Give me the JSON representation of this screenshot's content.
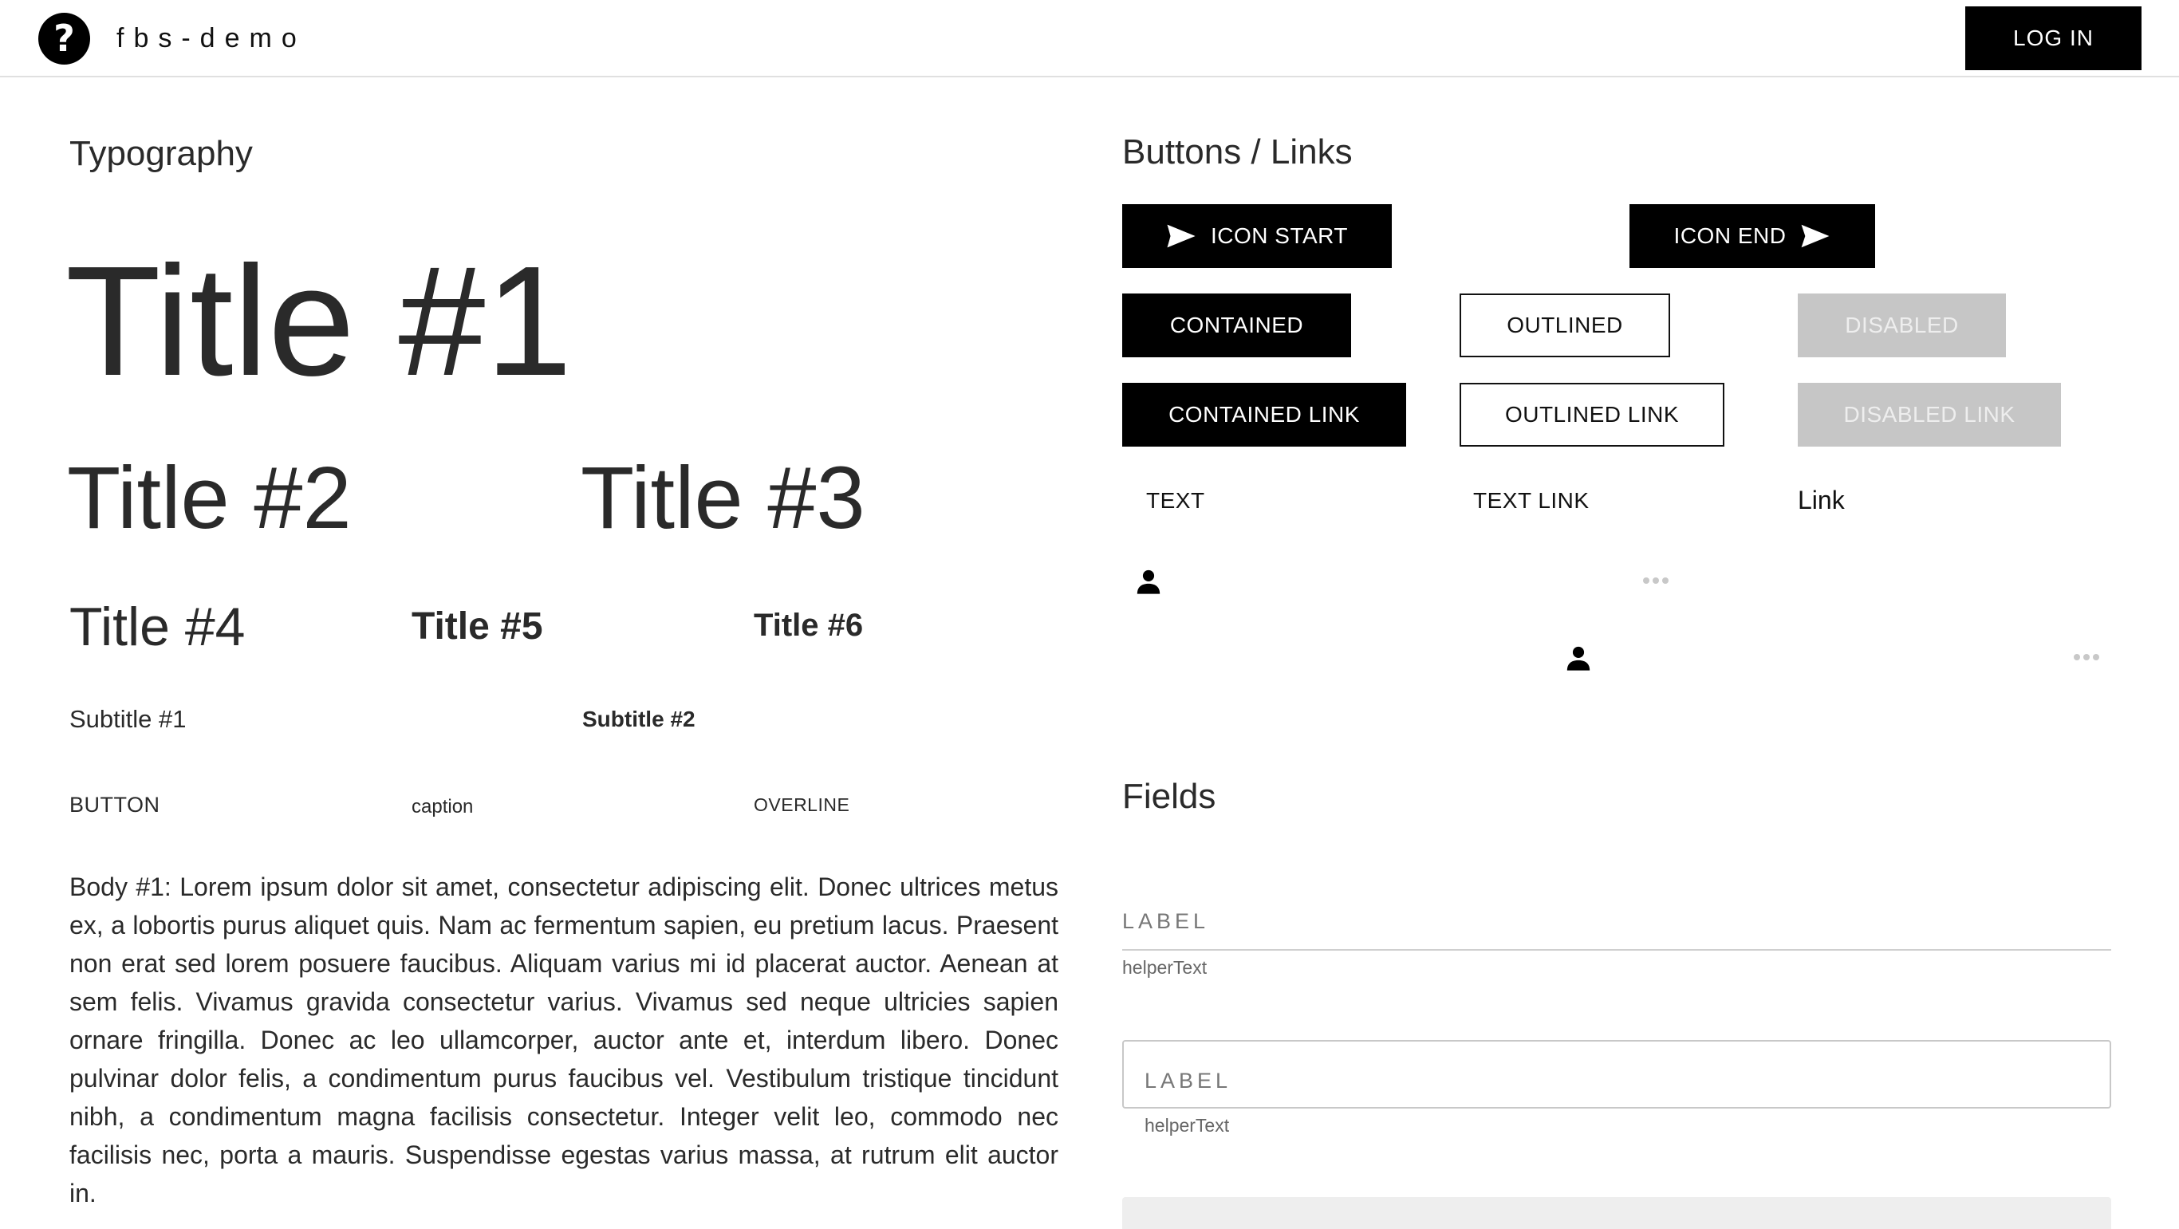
{
  "appbar": {
    "logo_glyph": "?",
    "title": "fbs-demo",
    "login_label": "LOG IN"
  },
  "typography": {
    "heading": "Typography",
    "title1": "Title #1",
    "title2": "Title #2",
    "title3": "Title #3",
    "title4": "Title #4",
    "title5": "Title #5",
    "title6": "Title #6",
    "subtitle1": "Subtitle #1",
    "subtitle2": "Subtitle #2",
    "button": "BUTTON",
    "caption": "caption",
    "overline": "OVERLINE",
    "body1": "Body #1: Lorem ipsum dolor sit amet, consectetur adipiscing elit. Donec ultrices metus ex, a lobortis purus aliquet quis. Nam ac fermentum sapien, eu pretium lacus. Praesent non erat sed lorem posuere faucibus. Aliquam varius mi id placerat auctor. Aenean at sem felis. Vivamus gravida consectetur varius. Vivamus sed neque ultricies sapien ornare fringilla. Donec ac leo ullamcorper, auctor ante et, interdum libero. Donec pulvinar dolor felis, a condimentum purus faucibus vel. Vestibulum tristique tincidunt nibh, a condimentum magna facilisis consectetur. Integer velit leo, commodo nec facilisis nec, porta a mauris. Suspendisse egestas varius massa, at rutrum elit auctor in."
  },
  "buttons": {
    "heading": "Buttons / Links",
    "icon_start": "ICON START",
    "icon_end": "ICON END",
    "contained": "CONTAINED",
    "outlined": "OUTLINED",
    "disabled": "DISABLED",
    "contained_link": "CONTAINED LINK",
    "outlined_link": "OUTLINED LINK",
    "disabled_link": "DISABLED LINK",
    "text": "TEXT",
    "text_link": "TEXT LINK",
    "link": "Link",
    "icons": [
      "send-icon",
      "person-icon",
      "more-horizontal-icon"
    ]
  },
  "fields": {
    "heading": "Fields",
    "standard": {
      "label": "LABEL",
      "helper": "helperText"
    },
    "outlined": {
      "label": "LABEL",
      "helper": "helperText"
    }
  },
  "colors": {
    "primary": "#000000",
    "disabled_bg": "#c6c6c6",
    "disabled_text": "#eeeeee",
    "text": "#2a2a2a"
  }
}
